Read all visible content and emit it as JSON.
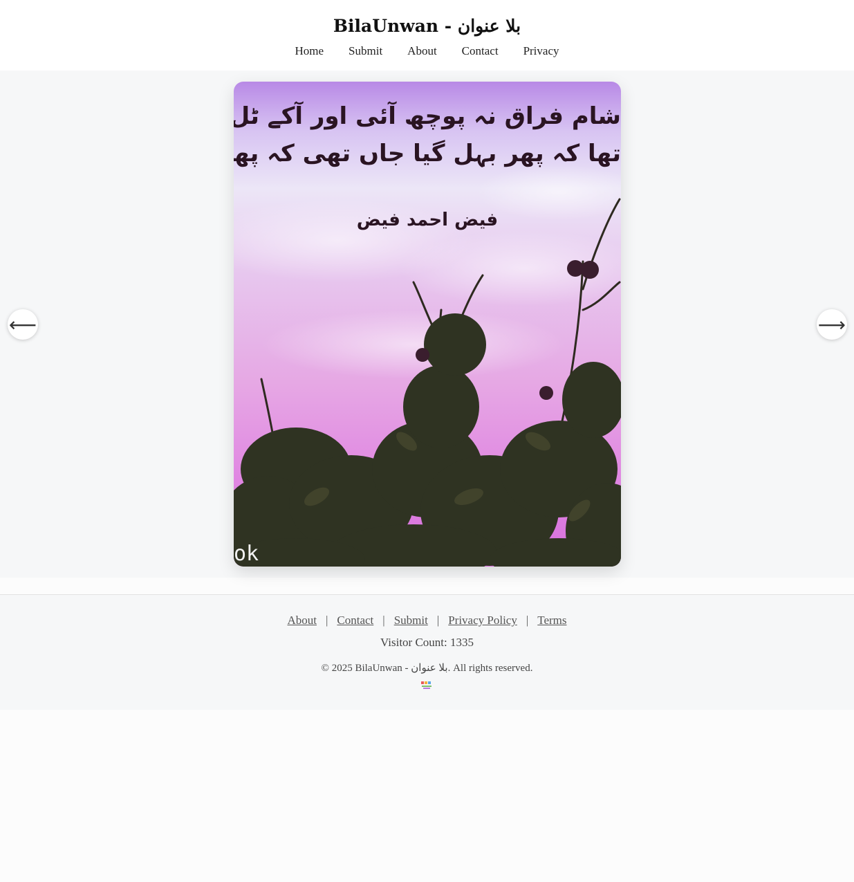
{
  "header": {
    "title": "BilaUnwan - بلا عنوان",
    "nav": [
      "Home",
      "Submit",
      "About",
      "Contact",
      "Privacy"
    ]
  },
  "gallery": {
    "poem_line_1": "شام فراق نہ پوچھ آئی اور آکے ٹل گئی",
    "poem_line_2": "تھا کہ پھر بہل گیا جاں تھی کہ پھر سنبھل",
    "poet": "فیض احمد فیض",
    "watermark": "ok",
    "prev_icon": "arrow-left-icon",
    "next_icon": "arrow-right-icon",
    "prev_glyph": "⟵",
    "next_glyph": "⟶",
    "colors": {
      "sky_top": "#b889e6",
      "sky_bottom": "#d66edc",
      "foliage": "#2f3322"
    }
  },
  "footer": {
    "links": [
      "About",
      "Contact",
      "Submit",
      "Privacy Policy",
      "Terms"
    ],
    "separator": "|",
    "visitor_count": "Visitor Count: 1335",
    "copyright": "© 2025 BilaUnwan - بلا عنوان. All rights reserved.",
    "logo_icon": "site-logo-icon"
  }
}
